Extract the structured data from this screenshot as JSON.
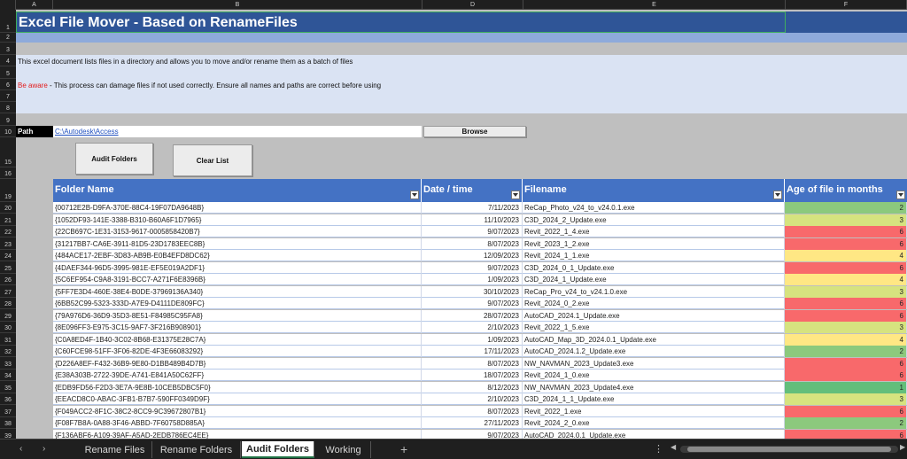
{
  "columns": [
    {
      "label": "A"
    },
    {
      "label": "B"
    },
    {
      "label": "D"
    },
    {
      "label": "E"
    },
    {
      "label": "F"
    }
  ],
  "rows": [
    "1",
    "2",
    "3",
    "4",
    "5",
    "6",
    "7",
    "8",
    "9",
    "10",
    "15",
    "16",
    "19",
    "20",
    "21",
    "22",
    "23",
    "24",
    "25",
    "26",
    "27",
    "28",
    "29",
    "30",
    "31",
    "32",
    "33",
    "34",
    "35",
    "36",
    "37",
    "38",
    "39"
  ],
  "title": "Excel File Mover - Based on RenameFiles",
  "info_line": "This excel document lists files in a directory and allows you to move and/or rename them as a batch of files",
  "warning": {
    "prefix": "Be aware",
    "text": " - This process can damage files if not used correctly. Ensure all names and paths are correct before using"
  },
  "path": {
    "label": "Path",
    "value": "C:\\Autodesk\\Access",
    "browse_label": "Browse"
  },
  "buttons": {
    "audit": "Audit Folders",
    "clear": "Clear List"
  },
  "table": {
    "headers": {
      "folder": "Folder Name",
      "date": "Date / time",
      "file": "Filename",
      "age": "Age of file in months"
    },
    "rows": [
      {
        "folder": "{00712E2B-D9FA-370E-88C4-19F07DA9648B}",
        "date": "7/11/2023",
        "file": "ReCap_Photo_v24_to_v24.0.1.exe",
        "age": "2"
      },
      {
        "folder": "{1052DF93-141E-3388-B310-B60A6F1D7965}",
        "date": "11/10/2023",
        "file": "C3D_2024_2_Update.exe",
        "age": "3"
      },
      {
        "folder": "{22CB697C-1E31-3153-9617-0005858420B7}",
        "date": "9/07/2023",
        "file": "Revit_2022_1_4.exe",
        "age": "6"
      },
      {
        "folder": "{31217BB7-CA6E-3911-81D5-23D1783EEC8B}",
        "date": "8/07/2023",
        "file": "Revit_2023_1_2.exe",
        "age": "6"
      },
      {
        "folder": "{484ACE17-2EBF-3D83-AB9B-E0B4EFD8DC62}",
        "date": "12/09/2023",
        "file": "Revit_2024_1_1.exe",
        "age": "4"
      },
      {
        "folder": "{4DAEF344-96D5-3995-981E-EF5E019A2DF1}",
        "date": "9/07/2023",
        "file": "C3D_2024_0_1_Update.exe",
        "age": "6"
      },
      {
        "folder": "{5C6EF954-C9A8-3191-BCC7-A271F6E8396B}",
        "date": "1/09/2023",
        "file": "C3D_2024_1_Update.exe",
        "age": "4"
      },
      {
        "folder": "{5FF7E3D4-460E-38E4-B0DE-37969136A340}",
        "date": "30/10/2023",
        "file": "ReCap_Pro_v24_to_v24.1.0.exe",
        "age": "3"
      },
      {
        "folder": "{6BB52C99-5323-333D-A7E9-D4111DE809FC}",
        "date": "9/07/2023",
        "file": "Revit_2024_0_2.exe",
        "age": "6"
      },
      {
        "folder": "{79A976D6-36D9-35D3-8E51-F84985C95FA8}",
        "date": "28/07/2023",
        "file": "AutoCAD_2024.1_Update.exe",
        "age": "6"
      },
      {
        "folder": "{8E096FF3-E975-3C15-9AF7-3F216B908901}",
        "date": "2/10/2023",
        "file": "Revit_2022_1_5.exe",
        "age": "3"
      },
      {
        "folder": "{C0A8ED4F-1B40-3C02-8B68-E31375E28C7A}",
        "date": "1/09/2023",
        "file": "AutoCAD_Map_3D_2024.0.1_Update.exe",
        "age": "4"
      },
      {
        "folder": "{C60FCE98-51FF-3F06-82DE-4F3E66083292}",
        "date": "17/11/2023",
        "file": "AutoCAD_2024.1.2_Update.exe",
        "age": "2"
      },
      {
        "folder": "{D226A8EF-F432-36B9-9E80-D1BB489B4D7B}",
        "date": "8/07/2023",
        "file": "NW_NAVMAN_2023_Update3.exe",
        "age": "6"
      },
      {
        "folder": "{E38A303B-2722-39DE-A741-E841A50C62FF}",
        "date": "18/07/2023",
        "file": "Revit_2024_1_0.exe",
        "age": "6"
      },
      {
        "folder": "{EDB9FD56-F2D3-3E7A-9E8B-10CEB5DBC5F0}",
        "date": "8/12/2023",
        "file": "NW_NAVMAN_2023_Update4.exe",
        "age": "1"
      },
      {
        "folder": "{EEACD8C0-ABAC-3FB1-B7B7-590FF0349D9F}",
        "date": "2/10/2023",
        "file": "C3D_2024_1_1_Update.exe",
        "age": "3"
      },
      {
        "folder": "{F049ACC2-8F1C-38C2-8CC9-9C39672807B1}",
        "date": "8/07/2023",
        "file": "Revit_2022_1.exe",
        "age": "6"
      },
      {
        "folder": "{F08F7B8A-0A88-3F46-ABBD-7F60758D885A}",
        "date": "27/11/2023",
        "file": "Revit_2024_2_0.exe",
        "age": "2"
      },
      {
        "folder": "{F136ABF6-A109-39AF-A5AD-2EDB786EC4EE}",
        "date": "9/07/2023",
        "file": "AutoCAD_2024.0.1_Update.exe",
        "age": "6"
      }
    ]
  },
  "age_colors": {
    "1": "#63be7b",
    "2": "#8cc97d",
    "3": "#d6e37f",
    "4": "#ffe784",
    "6": "#f8696b"
  },
  "sheet_tabs": [
    "Rename Files",
    "Rename Folders",
    "Audit Folders",
    "Working"
  ],
  "active_tab": "Audit Folders",
  "icons": {
    "prev_sheet": "chevron-left-icon",
    "next_sheet": "chevron-right-icon",
    "add_sheet": "plus-icon",
    "more": "more-vertical-icon"
  }
}
